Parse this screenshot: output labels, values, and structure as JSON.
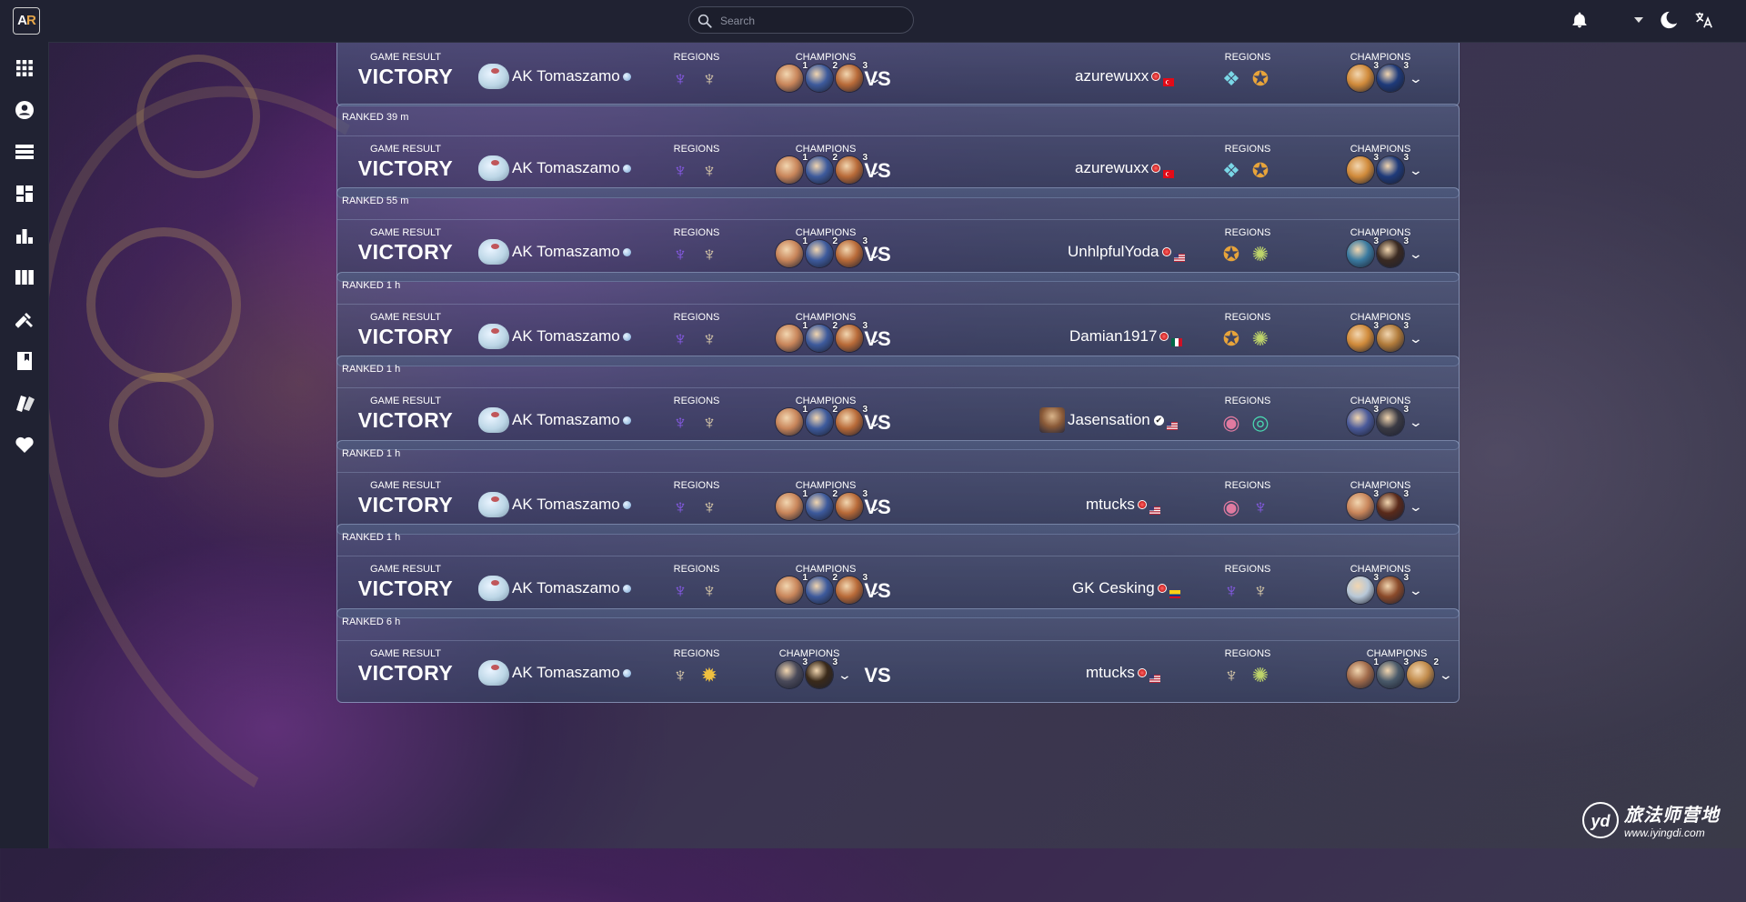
{
  "app": {
    "logo_a": "A",
    "logo_r": "R"
  },
  "search": {
    "placeholder": "Search"
  },
  "sidebar": {
    "items": [
      {
        "icon": "grid-icon"
      },
      {
        "icon": "account-icon"
      },
      {
        "icon": "list-icon"
      },
      {
        "icon": "dashboard-icon"
      },
      {
        "icon": "stats-icon"
      },
      {
        "icon": "columns-icon"
      },
      {
        "icon": "tools-icon"
      },
      {
        "icon": "book-icon"
      },
      {
        "icon": "cards-icon"
      },
      {
        "icon": "heart-icon"
      }
    ]
  },
  "labels": {
    "game_result": "GAME RESULT",
    "regions": "REGIONS",
    "champions": "CHAMPIONS",
    "vs": "VS"
  },
  "watermark": {
    "cn": "旅法师营地",
    "url": "www.iyingdi.com",
    "logo": "yd"
  },
  "games": [
    {
      "queue": "",
      "result": "VICTORY",
      "player": "AK Tomaszamo",
      "my_regions": [
        "void",
        "bilgewater"
      ],
      "my_champs": [
        {
          "c": "#c8855a",
          "s": "1"
        },
        {
          "c": "#3d5a9c",
          "s": "2"
        },
        {
          "c": "#b86a38",
          "s": "3"
        }
      ],
      "opponent": "azurewuxx",
      "opp_flag": "turkey",
      "opp_regions": [
        "freljord",
        "shurima"
      ],
      "opp_champs": [
        {
          "c": "#d08a3a",
          "s": "3"
        },
        {
          "c": "#1e3a7a",
          "s": "3"
        }
      ]
    },
    {
      "queue": "RANKED 39 m",
      "result": "VICTORY",
      "player": "AK Tomaszamo",
      "my_regions": [
        "void",
        "bilgewater"
      ],
      "my_champs": [
        {
          "c": "#c8855a",
          "s": "1"
        },
        {
          "c": "#3d5a9c",
          "s": "2"
        },
        {
          "c": "#b86a38",
          "s": "3"
        }
      ],
      "opponent": "azurewuxx",
      "opp_flag": "turkey",
      "opp_regions": [
        "freljord",
        "shurima"
      ],
      "opp_champs": [
        {
          "c": "#d08a3a",
          "s": "3"
        },
        {
          "c": "#1e3a7a",
          "s": "3"
        }
      ]
    },
    {
      "queue": "RANKED 55 m",
      "result": "VICTORY",
      "player": "AK Tomaszamo",
      "my_regions": [
        "void",
        "bilgewater"
      ],
      "my_champs": [
        {
          "c": "#c8855a",
          "s": "1"
        },
        {
          "c": "#3d5a9c",
          "s": "2"
        },
        {
          "c": "#b86a38",
          "s": "3"
        }
      ],
      "opponent": "UnhlpfulYoda",
      "opp_flag": "usa",
      "opp_regions": [
        "shurima",
        "targon"
      ],
      "opp_champs": [
        {
          "c": "#3a7aa0",
          "s": "3"
        },
        {
          "c": "#3a2a22",
          "s": "3"
        }
      ]
    },
    {
      "queue": "RANKED 1 h",
      "result": "VICTORY",
      "player": "AK Tomaszamo",
      "my_regions": [
        "void",
        "bilgewater"
      ],
      "my_champs": [
        {
          "c": "#c8855a",
          "s": "1"
        },
        {
          "c": "#3d5a9c",
          "s": "2"
        },
        {
          "c": "#b86a38",
          "s": "3"
        }
      ],
      "opponent": "Damian1917",
      "opp_flag": "mexico",
      "opp_regions": [
        "shurima",
        "targon"
      ],
      "opp_champs": [
        {
          "c": "#d08a3a",
          "s": "3"
        },
        {
          "c": "#b07a3a",
          "s": "3"
        }
      ]
    },
    {
      "queue": "RANKED 1 h",
      "result": "VICTORY",
      "player": "AK Tomaszamo",
      "my_regions": [
        "void",
        "bilgewater"
      ],
      "my_champs": [
        {
          "c": "#c8855a",
          "s": "1"
        },
        {
          "c": "#3d5a9c",
          "s": "2"
        },
        {
          "c": "#b86a38",
          "s": "3"
        }
      ],
      "opponent": "Jasensation",
      "opp_flag": "usa",
      "opp_regions": [
        "bandle",
        "shadow"
      ],
      "opp_champs": [
        {
          "c": "#4a5a9a",
          "s": "3"
        },
        {
          "c": "#3a3a44",
          "s": "3"
        }
      ]
    },
    {
      "queue": "RANKED 1 h",
      "result": "VICTORY",
      "player": "AK Tomaszamo",
      "my_regions": [
        "void",
        "bilgewater"
      ],
      "my_champs": [
        {
          "c": "#c8855a",
          "s": "1"
        },
        {
          "c": "#3d5a9c",
          "s": "2"
        },
        {
          "c": "#b86a38",
          "s": "3"
        }
      ],
      "opponent": "mtucks",
      "opp_flag": "usa",
      "opp_regions": [
        "bandle",
        "void"
      ],
      "opp_champs": [
        {
          "c": "#c8855a",
          "s": "3"
        },
        {
          "c": "#5a2a1a",
          "s": "3"
        }
      ]
    },
    {
      "queue": "RANKED 1 h",
      "result": "VICTORY",
      "player": "AK Tomaszamo",
      "my_regions": [
        "void",
        "bilgewater"
      ],
      "my_champs": [
        {
          "c": "#c8855a",
          "s": "1"
        },
        {
          "c": "#3d5a9c",
          "s": "2"
        },
        {
          "c": "#b86a38",
          "s": "3"
        }
      ],
      "opponent": "GK Cesking",
      "opp_flag": "colombia",
      "opp_regions": [
        "void",
        "bilgewater"
      ],
      "opp_champs": [
        {
          "c": "#b8c8d8",
          "s": "3"
        },
        {
          "c": "#8a4a2a",
          "s": "3"
        }
      ]
    },
    {
      "queue": "RANKED 6 h",
      "result": "VICTORY",
      "player": "AK Tomaszamo",
      "my_regions": [
        "bilgewater",
        "targon-sun"
      ],
      "my_champs": [
        {
          "c": "#4a4a5a",
          "s": "3"
        },
        {
          "c": "#3a2a1a",
          "s": "3"
        }
      ],
      "opponent": "mtucks",
      "opp_flag": "usa",
      "opp_regions": [
        "bilgewater",
        "targon"
      ],
      "opp_champs": [
        {
          "c": "#a06a4a",
          "s": "1"
        },
        {
          "c": "#4a5a6a",
          "s": "3"
        },
        {
          "c": "#c08a4a",
          "s": "2"
        }
      ]
    }
  ]
}
